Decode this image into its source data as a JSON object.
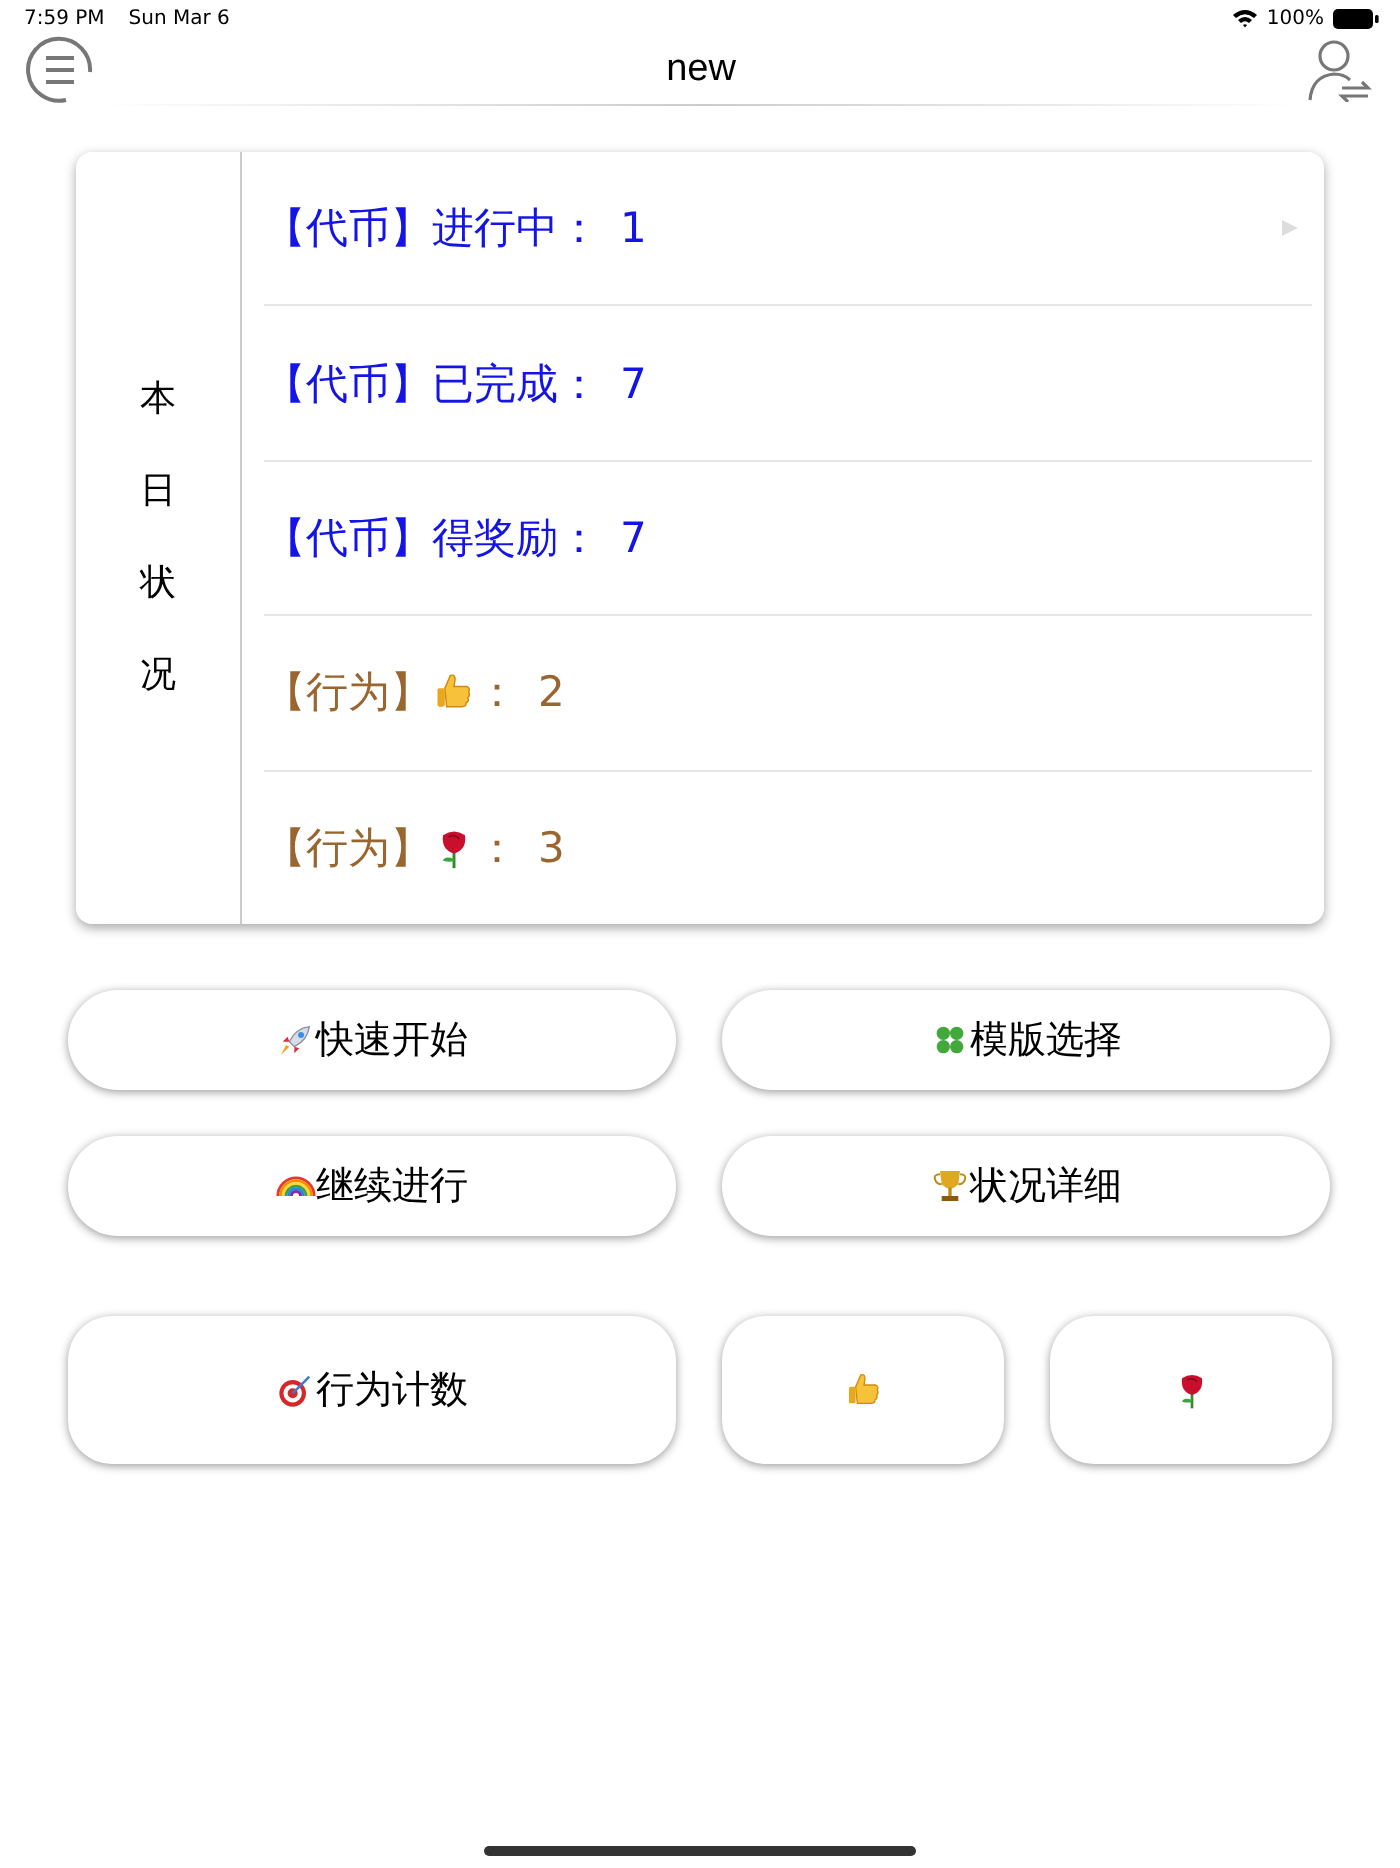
{
  "status_bar": {
    "time": "7:59 PM",
    "date": "Sun Mar 6",
    "battery": "100%"
  },
  "nav": {
    "title": "new"
  },
  "summary": {
    "side_label": "本日状况",
    "rows": [
      {
        "kind": "token",
        "tag": "【代币】",
        "label": "进行中：",
        "value": "1",
        "arrow": true
      },
      {
        "kind": "token",
        "tag": "【代币】",
        "label": "已完成：",
        "value": "7",
        "arrow": false
      },
      {
        "kind": "token",
        "tag": "【代币】",
        "label": "得奖励：",
        "value": "7",
        "arrow": false
      },
      {
        "kind": "behavior",
        "tag": "【行为】",
        "icon": {
          "kind": "thumb"
        },
        "label": "：",
        "value": "2",
        "arrow": false
      },
      {
        "kind": "behavior",
        "tag": "【行为】",
        "icon": {
          "kind": "rose"
        },
        "label": "：",
        "value": "3",
        "arrow": false
      }
    ]
  },
  "buttons": [
    {
      "kind": "rocket",
      "label": "快速开始"
    },
    {
      "kind": "clover",
      "label": "模版选择"
    },
    {
      "kind": "rainbow",
      "label": "继续进行"
    },
    {
      "kind": "trophy",
      "label": "状况详细"
    }
  ],
  "counter_buttons": [
    {
      "kind": "target",
      "label": "行为计数"
    },
    {
      "kind": "thumb"
    },
    {
      "kind": "rose"
    }
  ]
}
